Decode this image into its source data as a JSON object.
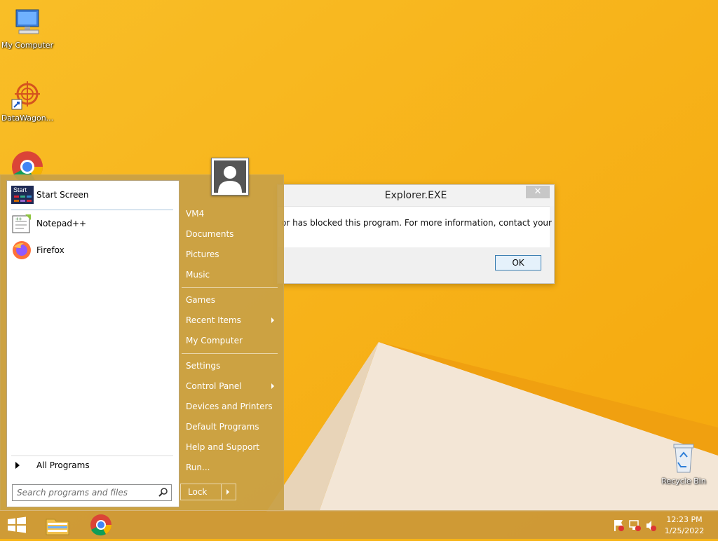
{
  "desktop": {
    "icons": [
      {
        "label": "My Computer"
      },
      {
        "label": "DataWagon..."
      },
      {
        "label": "Google Chrome"
      },
      {
        "label": "Recycle Bin"
      }
    ]
  },
  "dialog": {
    "title": "Explorer.EXE",
    "close_label": "✕",
    "message": "or has blocked this program. For more information, contact your",
    "ok_label": "OK"
  },
  "start_menu": {
    "programs": [
      {
        "label": "Start Screen",
        "icon": "start-screen-icon"
      },
      {
        "label": "Notepad++",
        "icon": "notepad-plus-plus-icon"
      },
      {
        "label": "Firefox",
        "icon": "firefox-icon"
      }
    ],
    "all_programs_label": "All Programs",
    "search_placeholder": "Search programs and files",
    "right_items": [
      {
        "label": "VM4"
      },
      {
        "label": "Documents"
      },
      {
        "label": "Pictures"
      },
      {
        "label": "Music"
      },
      {
        "label": "Games"
      },
      {
        "label": "Recent Items",
        "submenu": true
      },
      {
        "label": "My Computer"
      },
      {
        "label": "Settings"
      },
      {
        "label": "Control Panel",
        "submenu": true
      },
      {
        "label": "Devices and Printers"
      },
      {
        "label": "Default Programs"
      },
      {
        "label": "Help and Support"
      },
      {
        "label": "Run..."
      }
    ],
    "lock_label": "Lock"
  },
  "taskbar": {
    "apps": [
      "start-button",
      "file-explorer",
      "chrome"
    ],
    "clock_time": "12:23 PM",
    "clock_date": "1/25/2022"
  },
  "colors": {
    "desktop_bg": "#f7b416",
    "accent": "#c9a04a"
  }
}
